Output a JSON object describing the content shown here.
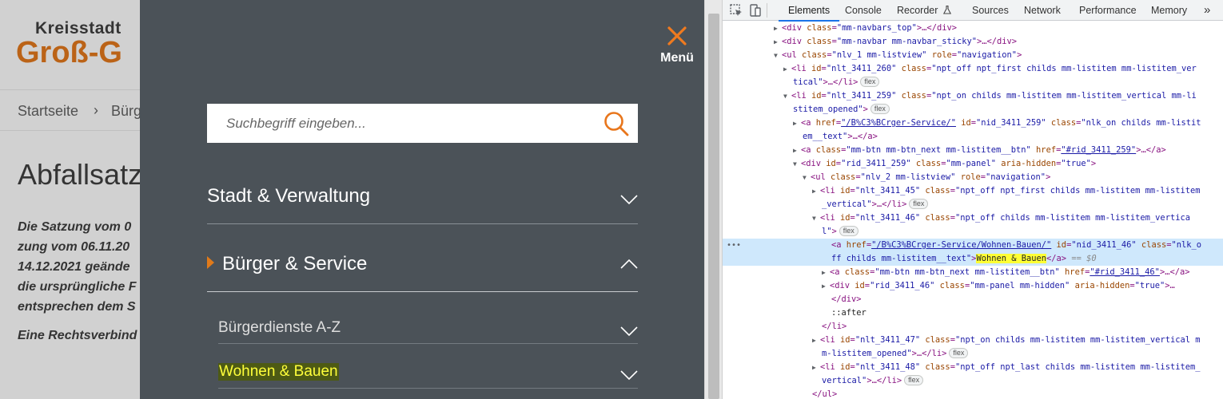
{
  "site": {
    "logo_top": "Kreisstadt",
    "logo_main": "Groß-G",
    "breadcrumb_home": "Startseite",
    "breadcrumb_sep": "›",
    "breadcrumb_current": "Bürg",
    "title": "Abfallsatz",
    "intro_lines": [
      "Die Satzung vom 0",
      "zung vom 06.11.20",
      "14.12.2021 geände",
      "die ursprüngliche F",
      "entsprechen dem S"
    ],
    "legal_text": "Eine Rechtsverbind"
  },
  "menu": {
    "close_label": "Menü",
    "search_placeholder": "Suchbegriff eingeben...",
    "items": [
      {
        "label": "Stadt & Verwaltung"
      },
      {
        "label": "Bürger & Service"
      }
    ],
    "subitems": [
      {
        "label": "Bürgerdienste A-Z"
      },
      {
        "label": "Wohnen & Bauen"
      }
    ]
  },
  "devtools": {
    "tabs": [
      "Elements",
      "Console",
      "Recorder",
      "Sources",
      "Network",
      "Performance",
      "Memory"
    ],
    "more": "»",
    "selected_tab": "Elements",
    "badge": "flex",
    "selected_node_text": "Wohnen & Bauen",
    "dollar_ref": "== $0",
    "lines": [
      {
        "t1": "<div ",
        "a1": "class",
        "v1": "\"mm-navbars_top\"",
        "rest": ">…</div>"
      },
      {
        "t1": "<div ",
        "a1": "class",
        "v1": "\"mm-navbar mm-navbar_sticky\"",
        "rest": ">…</div>"
      },
      {
        "t1": "<ul ",
        "a1": "class",
        "v1": "\"nlv_1 mm-listview\"",
        "a2": " role",
        "v2": "\"navigation\"",
        "rest": ">"
      },
      {
        "t1": "<li ",
        "a1": "id",
        "v1": "\"nlt_3411_260\"",
        "a2": " class",
        "v2": "\"npt_off npt_first childs mm-listitem mm-listitem_ver",
        "cont": "tical\"",
        "rest": ">…</li>"
      },
      {
        "t1": "<li ",
        "a1": "id",
        "v1": "\"nlt_3411_259\"",
        "a2": " class",
        "v2": "\"npt_on childs mm-listitem mm-listitem_vertical mm-li",
        "cont": "stitem_opened\"",
        "rest": ">"
      },
      {
        "t1": "<a ",
        "a1": "href",
        "v1": "\"/B%C3%BCrger-Service/\"",
        "a2": " id",
        "v2": "\"nid_3411_259\"",
        "a3": " class",
        "v3": "\"nlk_on childs mm-listit",
        "cont": "em__text\"",
        "rest": ">…</a>"
      },
      {
        "t1": "<a ",
        "a1": "class",
        "v1": "\"mm-btn mm-btn_next mm-listitem__btn\"",
        "a2": " href",
        "v2": "\"#rid_3411_259\"",
        "rest": ">…</a>"
      },
      {
        "t1": "<div ",
        "a1": "id",
        "v1": "\"rid_3411_259\"",
        "a2": " class",
        "v2": "\"mm-panel\"",
        "a3": " aria-hidden",
        "v3": "\"true\"",
        "rest": ">"
      },
      {
        "t1": "<ul ",
        "a1": "class",
        "v1": "\"nlv_2 mm-listview\"",
        "a2": " role",
        "v2": "\"navigation\"",
        "rest": ">"
      },
      {
        "t1": "<li ",
        "a1": "id",
        "v1": "\"nlt_3411_45\"",
        "a2": " class",
        "v2": "\"npt_off npt_first childs mm-listitem mm-listitem",
        "cont": "_vertical\"",
        "rest": ">…</li>"
      },
      {
        "t1": "<li ",
        "a1": "id",
        "v1": "\"nlt_3411_46\"",
        "a2": " class",
        "v2": "\"npt_off childs mm-listitem mm-listitem_vertica",
        "cont": "l\"",
        "rest": ">"
      },
      {
        "t1": "<a ",
        "a1": "href",
        "v1": "\"/B%C3%BCrger-Service/Wohnen-Bauen/\"",
        "a2": " id",
        "v2": "\"nid_3411_46\"",
        "a3": " class",
        "v3": "\"nlk_o",
        "cont": "ff childs mm-listitem__text\"",
        "rest": ">"
      },
      {
        "t1": "<a ",
        "a1": "class",
        "v1": "\"mm-btn mm-btn_next mm-listitem__btn\"",
        "a2": " href",
        "v2": "\"#rid_3411_46\"",
        "rest": ">…</a>"
      },
      {
        "t1": "<div ",
        "a1": "id",
        "v1": "\"rid_3411_46\"",
        "a2": " class",
        "v2": "\"mm-panel mm-hidden\"",
        "a3": " aria-hidden",
        "v3": "\"true\"",
        "rest": ">…"
      },
      {
        "rest": "</div>"
      },
      {
        "rest": "::after"
      },
      {
        "rest": "</li>"
      },
      {
        "t1": "<li ",
        "a1": "id",
        "v1": "\"nlt_3411_47\"",
        "a2": " class",
        "v2": "\"npt_on childs mm-listitem mm-listitem_vertical m",
        "cont": "m-listitem_opened\"",
        "rest": ">…</li>"
      },
      {
        "t1": "<li ",
        "a1": "id",
        "v1": "\"nlt_3411_48\"",
        "a2": " class",
        "v2": "\"npt_off npt_last childs mm-listitem mm-listitem_",
        "cont": "vertical\"",
        "rest": ">…</li>"
      },
      {
        "rest": "</ul>"
      }
    ]
  }
}
